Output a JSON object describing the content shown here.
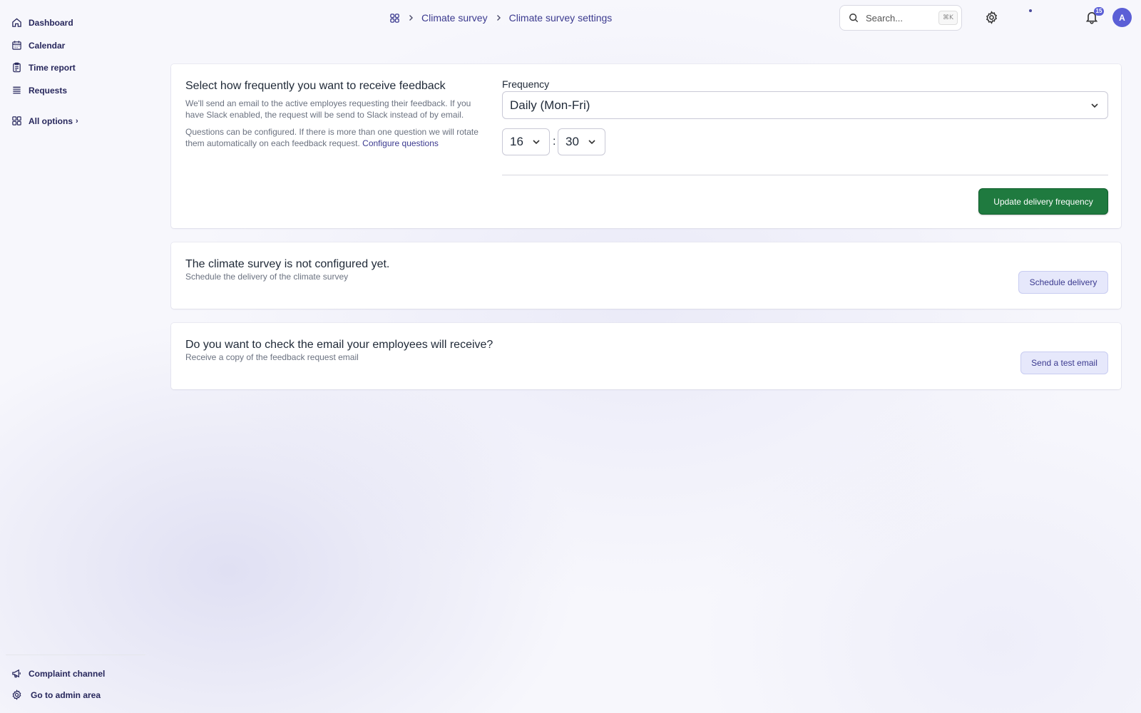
{
  "sidebar": {
    "items": [
      {
        "label": "Dashboard"
      },
      {
        "label": "Calendar"
      },
      {
        "label": "Time report"
      },
      {
        "label": "Requests"
      },
      {
        "label": "All options"
      }
    ],
    "footer": [
      {
        "label": "Complaint channel"
      },
      {
        "label": "Go to admin area"
      }
    ]
  },
  "header": {
    "breadcrumb": [
      "Climate survey",
      "Climate survey settings"
    ],
    "search": {
      "placeholder": "Search...",
      "shortcut": "⌘K"
    },
    "notifications_count": "15",
    "avatar_initial": "A"
  },
  "frequency_card": {
    "title": "Select how frequently you want to receive feedback",
    "paragraph1": "We'll send an email to the active employes requesting their feedback. If you have Slack enabled, the request will be send to Slack instead of by email.",
    "paragraph2": "Questions can be configured. If there is more than one question we will rotate them automatically on each feedback request.",
    "configure_link": "Configure questions",
    "frequency_label": "Frequency",
    "frequency_value": "Daily (Mon-Fri)",
    "hour": "16",
    "minute": "30",
    "time_separator": ":",
    "submit_label": "Update delivery frequency"
  },
  "schedule_card": {
    "title": "The climate survey is not configured yet.",
    "subtitle": "Schedule the delivery of the climate survey",
    "button_label": "Schedule delivery"
  },
  "test_email_card": {
    "title": "Do you want to check the email your employees will receive?",
    "subtitle": "Receive a copy of the feedback request email",
    "button_label": "Send a test email"
  },
  "colors": {
    "primary_button": "#1f7a3f",
    "accent": "#5b5fd6",
    "link": "#3b3a8f"
  }
}
